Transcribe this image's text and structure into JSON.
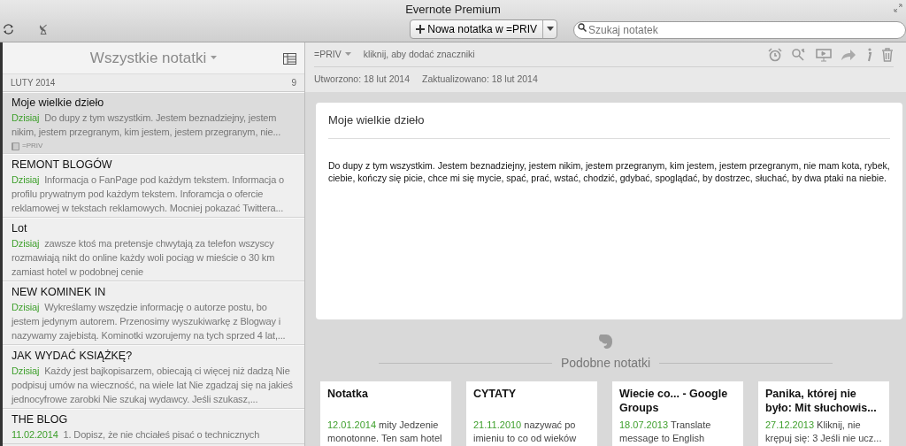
{
  "window": {
    "title": "Evernote Premium"
  },
  "toolbar": {
    "new_note_button": "Nowa notatka w =PRIV",
    "search": {
      "placeholder": "Szukaj notatek"
    }
  },
  "note_list": {
    "title": "Wszystkie notatki",
    "group": {
      "label": "LUTY 2014",
      "count": "9"
    },
    "notes": [
      {
        "title": "Moje wielkie dzieło",
        "date": "Dzisiaj",
        "snippet": "Do dupy z tym wszystkim. Jestem beznadziejny, jestem nikim, jestem przegranym, kim jestem, jestem przegranym, nie...",
        "notebook": "=PRIV",
        "selected": true
      },
      {
        "title": "REMONT BLOGÓW",
        "date": "Dzisiaj",
        "snippet": "Informacja o FanPage pod każdym tekstem. Informacja o profilu prywatnym pod każdym tekstem. Inforamcja o ofercie reklamowej w tekstach reklamowych. Mocniej pokazać Twittera...",
        "selected": false
      },
      {
        "title": "Lot",
        "date": "Dzisiaj",
        "snippet": "zawsze ktoś ma pretensje chwytają za telefon wszyscy rozmawiają nikt do online każdy woli pociąg w mieście o 30 km zamiast hotel w podobnej cenie",
        "selected": false
      },
      {
        "title": "NEW KOMINEK IN",
        "date": "Dzisiaj",
        "snippet": "Wykreślamy wszędzie informację o autorze postu, bo jestem jedynym autorem. Przenosimy wyszukiwarkę z Blogway i nazywamy zajebistą. Kominotki wzorujemy na tych sprzed 4 lat,...",
        "selected": false
      },
      {
        "title": "JAK WYDAĆ KSIĄŻKĘ?",
        "date": "Dzisiaj",
        "snippet": "Każdy jest bajkopisarzem, obiecają ci więcej niż dadzą Nie podpisuj umów na wieczność, na wiele lat Nie zgadzaj się na jakieś jednocyfrowe zarobki Nie szukaj wydawcy. Jeśli szukasz,...",
        "selected": false
      },
      {
        "title": "THE BLOG",
        "date": "11.02.2014",
        "snippet": "1. Dopisz, że nie chciałeś pisać o technicznych",
        "selected": false
      }
    ]
  },
  "note_header": {
    "notebook": "=PRIV",
    "tags_placeholder": "kliknij, aby dodać znaczniki",
    "created": "Utworzono: 18 lut 2014",
    "updated": "Zaktualizowano: 18 lut 2014"
  },
  "editor": {
    "title": "Moje wielkie dzieło",
    "body": "Do dupy z tym wszystkim. Jestem beznadziejny, jestem nikim, jestem przegranym, kim jestem, jestem przegranym, nie mam kota, rybek, ciebie, kończy się picie, chce mi się mycie, spać, prać, wstać, chodzić, gdybać, spoglądać, by dostrzec, słuchać, by dwa ptaki na niebie."
  },
  "similar": {
    "title": "Podobne notatki",
    "notes": [
      {
        "title": "Notatka",
        "date": "12.01.2014",
        "snippet": "mity Jedzenie monotonne. Ten sam hotel"
      },
      {
        "title": "CYTATY",
        "date": "21.11.2010",
        "snippet": "nazywać po imieniu to co od wieków"
      },
      {
        "title": "Wiecie co... - Google Groups",
        "date": "18.07.2013",
        "snippet": "Translate message to English"
      },
      {
        "title": "Panika, której nie było: Mit słuchowis...",
        "date": "27.12.2013",
        "snippet": "Kliknij, nie krępuj się: 3 Jeśli nie ucz..."
      }
    ]
  }
}
